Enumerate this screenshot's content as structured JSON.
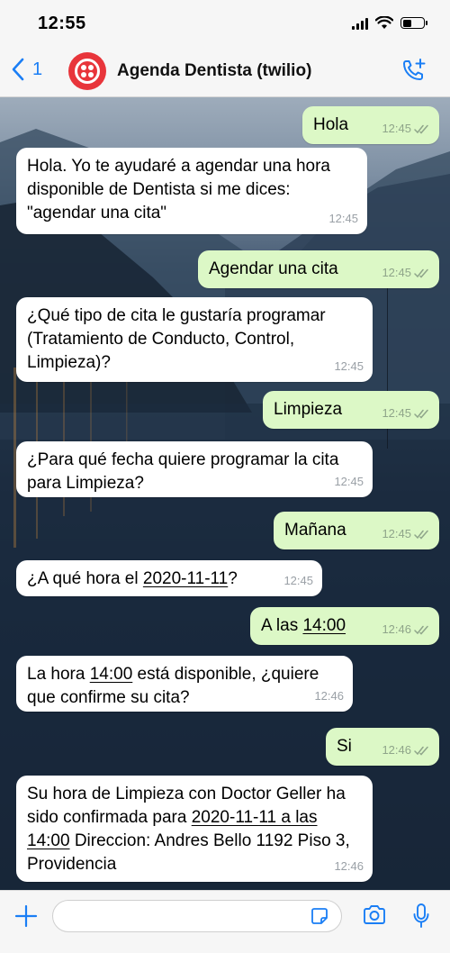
{
  "status_bar": {
    "time": "12:55"
  },
  "header": {
    "back_count": "1",
    "contact_name": "Agenda Dentista (twilio)"
  },
  "colors": {
    "accent": "#1a7ef5",
    "outgoing_bubble": "#dcf8c6",
    "incoming_bubble": "#ffffff",
    "avatar": "#e8353b"
  },
  "messages": [
    {
      "direction": "out",
      "parts": [
        {
          "t": "Hola"
        }
      ],
      "time": "12:45",
      "read": true
    },
    {
      "direction": "in",
      "parts": [
        {
          "t": "Hola. Yo te ayudaré a agendar una hora disponible de Dentista si me dices: \"agendar una cita\""
        }
      ],
      "time": "12:45"
    },
    {
      "direction": "out",
      "parts": [
        {
          "t": "Agendar una cita"
        }
      ],
      "time": "12:45",
      "read": true
    },
    {
      "direction": "in",
      "parts": [
        {
          "t": "¿Qué tipo de cita le gustaría programar (Tratamiento de Conducto, Control, Limpieza)?"
        }
      ],
      "time": "12:45"
    },
    {
      "direction": "out",
      "parts": [
        {
          "t": "Limpieza"
        }
      ],
      "time": "12:45",
      "read": true
    },
    {
      "direction": "in",
      "parts": [
        {
          "t": "¿Para qué fecha quiere programar la cita para Limpieza?"
        }
      ],
      "time": "12:45"
    },
    {
      "direction": "out",
      "parts": [
        {
          "t": "Mañana"
        }
      ],
      "time": "12:45",
      "read": true
    },
    {
      "direction": "in",
      "parts": [
        {
          "t": "¿A qué hora el "
        },
        {
          "t": "2020-11-11",
          "u": true
        },
        {
          "t": "?"
        }
      ],
      "time": "12:45"
    },
    {
      "direction": "out",
      "parts": [
        {
          "t": "A las "
        },
        {
          "t": "14:00",
          "u": true
        }
      ],
      "time": "12:46",
      "read": true
    },
    {
      "direction": "in",
      "parts": [
        {
          "t": "La hora "
        },
        {
          "t": "14:00",
          "u": true
        },
        {
          "t": " está disponible, ¿quiere que confirme su cita?"
        }
      ],
      "time": "12:46"
    },
    {
      "direction": "out",
      "parts": [
        {
          "t": "Si"
        }
      ],
      "time": "12:46",
      "read": true
    },
    {
      "direction": "in",
      "parts": [
        {
          "t": "Su hora de Limpieza con Doctor Geller ha sido confirmada para "
        },
        {
          "t": "2020-11-11 a las 14:00",
          "u": true
        },
        {
          "t": " Direccion: Andres Bello 1192 Piso 3, Providencia"
        }
      ],
      "time": "12:46"
    }
  ],
  "input": {
    "value": "",
    "placeholder": ""
  }
}
